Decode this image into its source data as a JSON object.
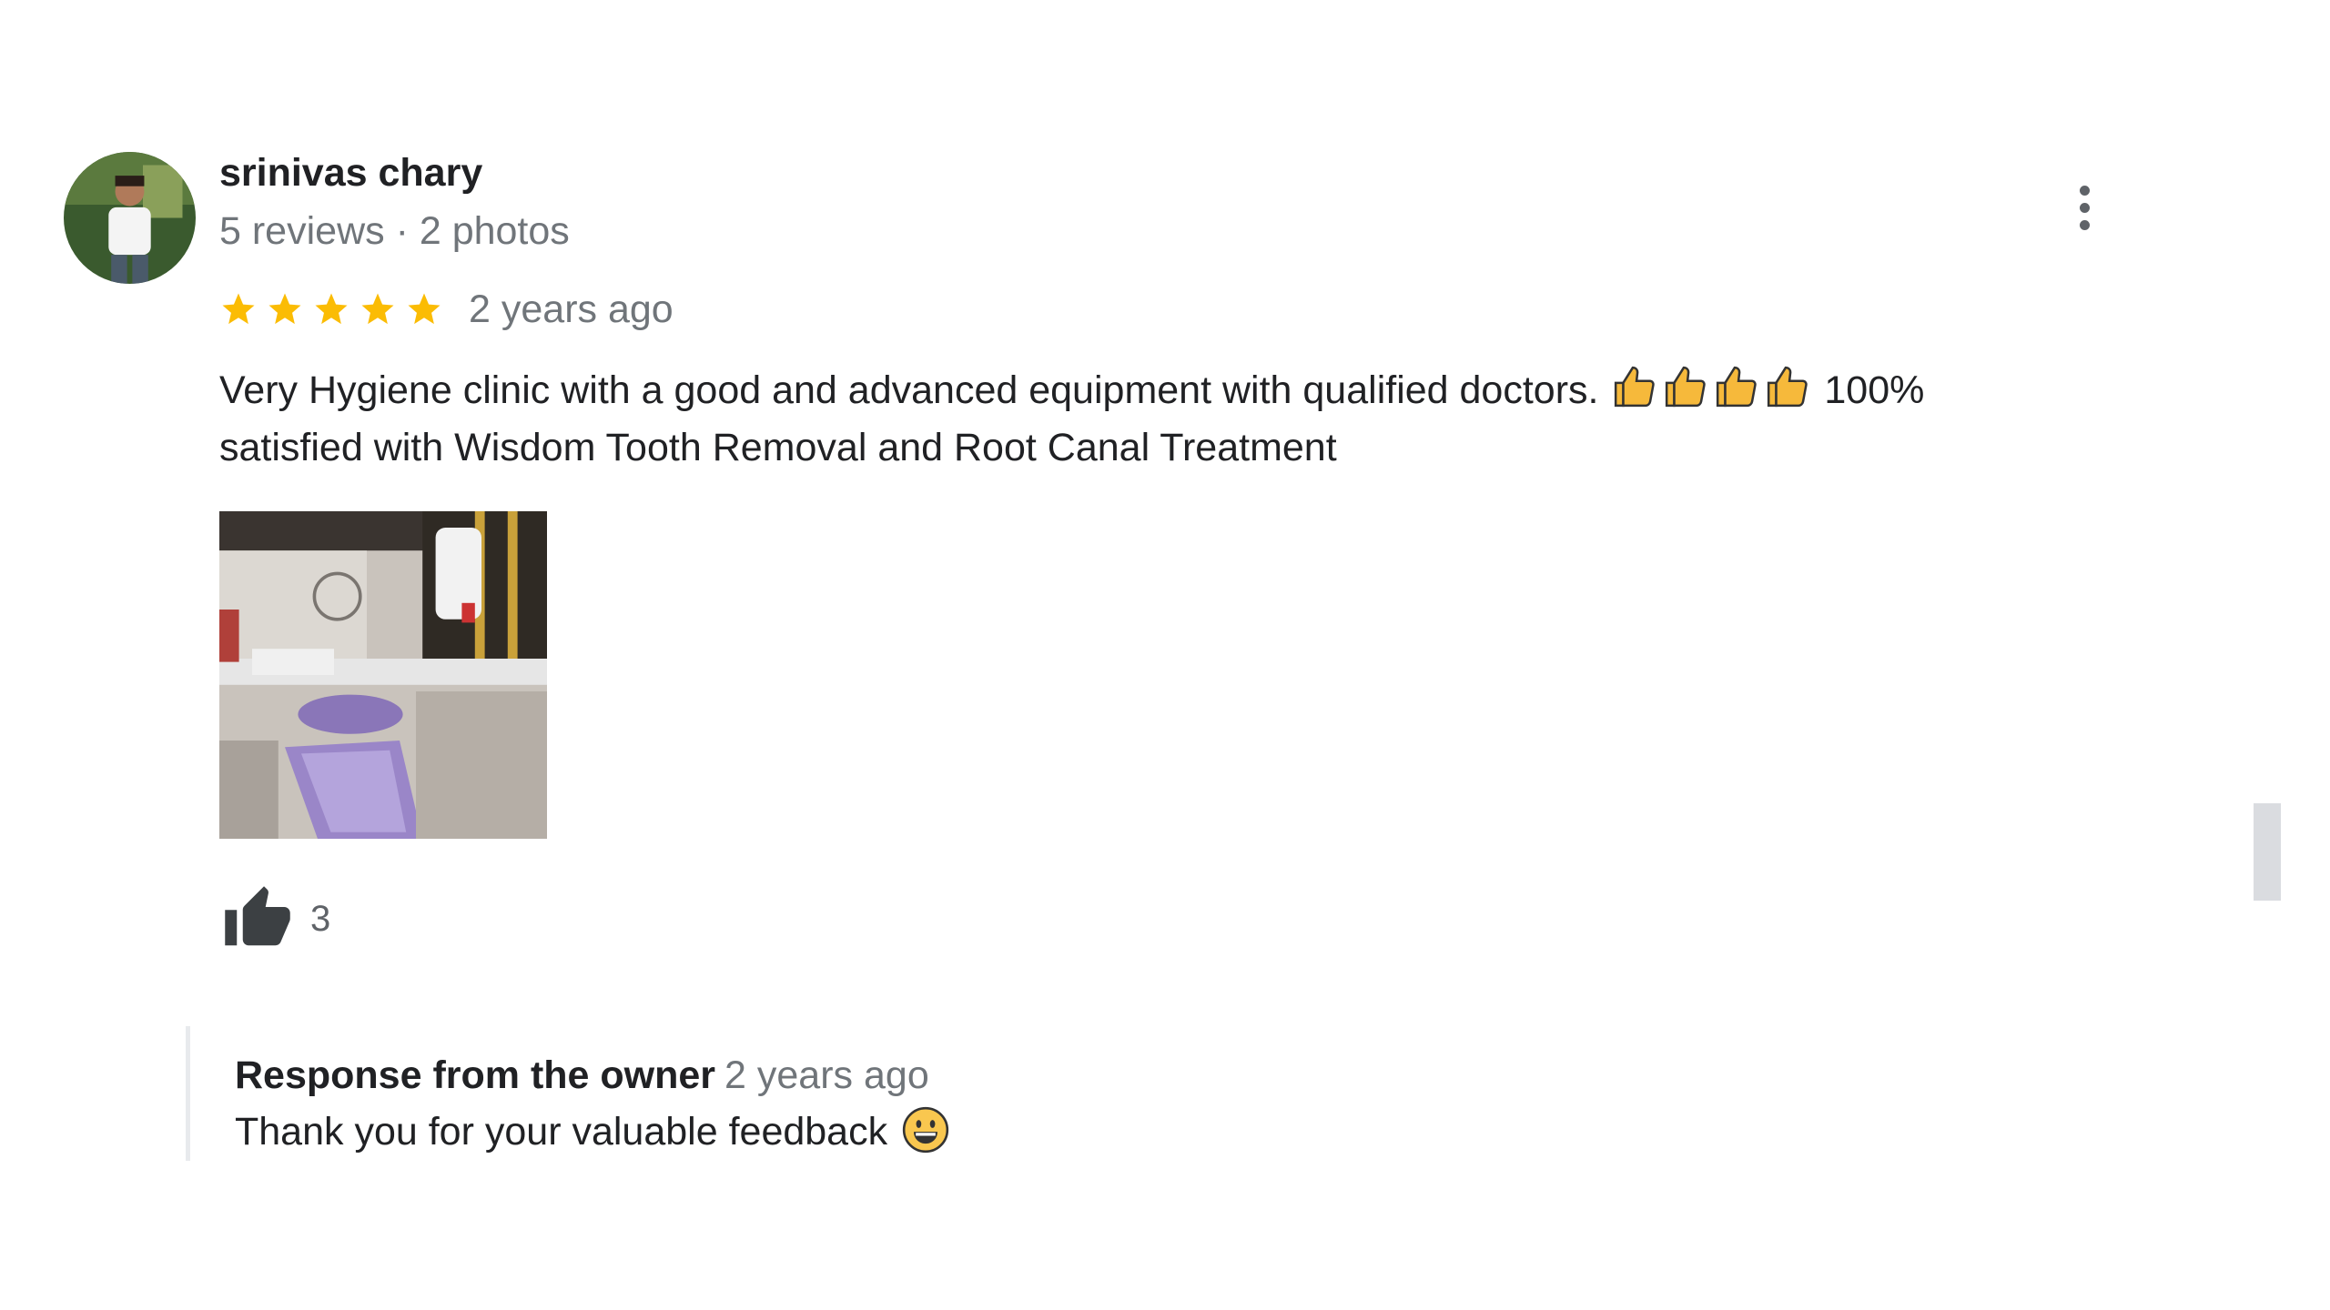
{
  "review": {
    "reviewer": {
      "name": "srinivas chary",
      "meta": "5 reviews · 2 photos",
      "avatar_icon": "person-photo"
    },
    "rating": 5,
    "rating_max": 5,
    "date": "2 years ago",
    "text_part1": "Very Hygiene clinic with a good and advanced equipment with qualified doctors.",
    "thumbs_emoji_count": 4,
    "text_part2": "100% satisfied with Wisdom Tooth Removal and Root Canal Treatment",
    "photo_icon": "dental-chair-photo",
    "likes": "3",
    "more_icon": "more-vertical-icon",
    "like_icon": "thumbs-up-icon"
  },
  "owner_response": {
    "title": "Response from the owner",
    "date": "2 years ago",
    "text": "Thank you for your valuable feedback",
    "emoji": "grinning-face-emoji"
  },
  "colors": {
    "star": "#fbbc04",
    "primary_text": "#202124",
    "secondary_text": "#70757a",
    "icon": "#5f6368",
    "divider": "#e8eaed"
  }
}
